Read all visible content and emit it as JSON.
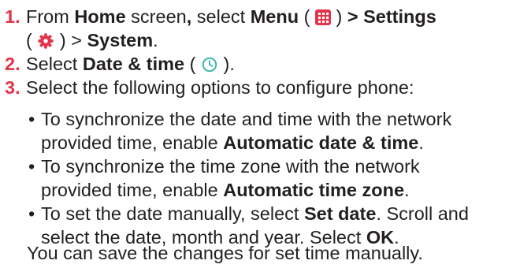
{
  "steps": [
    {
      "num": "1.",
      "line1_a": "From ",
      "line1_b": "Home",
      "line1_c": " screen",
      "line1_d": ",",
      "line1_e": " select ",
      "line1_f": "Menu",
      "line1_g": " ( ",
      "line1_h": " ) ",
      "line1_i": "> Settings",
      "line2_a": "( ",
      "line2_b": " ) > ",
      "line2_c": "System",
      "line2_d": "."
    },
    {
      "num": "2.",
      "a": "Select ",
      "b": "Date & time",
      "c": " ( ",
      "d": " )."
    },
    {
      "num": "3.",
      "text": "Select the following options to configure phone:"
    }
  ],
  "bullets": [
    {
      "line1": "To synchronize the date and time with the network",
      "line2_a": "provided time, enable ",
      "line2_b": "Automatic date & time",
      "line2_c": "."
    },
    {
      "line1": "To synchronize the time zone with the network",
      "line2_a": "provided time, enable ",
      "line2_b": "Automatic time zone",
      "line2_c": "."
    },
    {
      "line1_a": "To set the date manually, select ",
      "line1_b": "Set date",
      "line1_c": ". Scroll and",
      "line2_a": "select the date, month and year. Select ",
      "line2_b": "OK",
      "line2_c": "."
    }
  ],
  "note": "You can save the changes for set time manually.",
  "icons": {
    "menu": "menu-grid-icon",
    "settings": "gear-icon",
    "date_time": "clock-icon"
  },
  "colors": {
    "step_number": "#e2344a",
    "icon_accent": "#e2344a",
    "clock": "#2bb5a6",
    "text": "#231f20"
  }
}
